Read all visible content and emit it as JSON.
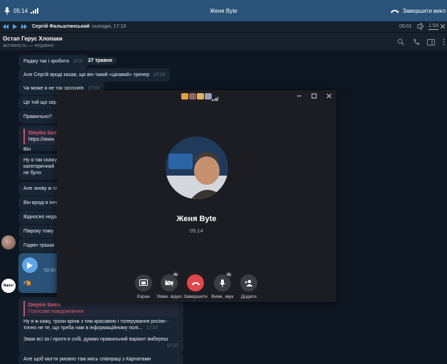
{
  "call_bar": {
    "timer": "05:14",
    "contact_name": "Женя Byte",
    "end_label": "Завершити викл"
  },
  "player_bar": {
    "author": "Сергій Фальштинський",
    "when": "сьогодні, 17:13",
    "position": "00:01",
    "speed": "1.5X"
  },
  "chat_header": {
    "title": "Остап Герус Хлопаки",
    "status": "активність — недавно"
  },
  "chat": {
    "date_pill": "27 травня",
    "messages": [
      {
        "text": "Раджу так і зробити",
        "time": "17:0"
      },
      {
        "text": "Але Сергій вроді казав, що він такий «цікавий» тренер",
        "time": "17:02"
      },
      {
        "text": "Чи може я не так зрозумів",
        "time": "17:03"
      },
      {
        "text": "Це той що зар"
      },
      {
        "text": "Правильно?"
      },
      {
        "reply_name": "Dmytro Som",
        "link": "https://www.",
        "text": "Він"
      },
      {
        "text": "Ну я так скажу",
        "text2": "категоричний",
        "text3": "не було"
      },
      {
        "text": "Але знову ж та"
      },
      {
        "text": "Він вроді в інте"
      },
      {
        "text": "Відносно неда"
      },
      {
        "text": "Півроку тому"
      },
      {
        "text": "Годвін трішки"
      },
      {
        "voice_time": "02:42"
      },
      {
        "reply_name": "Dmytro Soms",
        "reply_sub": "Голосове повідомлення",
        "text": "Ну я ж кажу, трохи крінж з тим красавою і толерування росіян -",
        "text2": "точно не те, що треба нам в інформаційному полі...",
        "time": "17:27"
      },
      {
        "text": "Зваж всі за і проти в собі, думаю правильний варіант вибереш",
        "time": "17:27"
      },
      {
        "text": "Але щоб могти умовно там якісь співпраці з Карпатами"
      }
    ],
    "avatar_label": "Nano!"
  },
  "call_window": {
    "contact_name": "Женя Byte",
    "duration": "05:14",
    "buttons": [
      {
        "label": "Екран",
        "icon": "screen-share-icon"
      },
      {
        "label": "Увімк. відео",
        "icon": "video-off-icon"
      },
      {
        "label": "Завершити",
        "icon": "hangup-icon"
      },
      {
        "label": "Вимк. звук",
        "icon": "microphone-icon"
      },
      {
        "label": "Додати",
        "icon": "add-user-icon"
      }
    ]
  },
  "colors": {
    "call_bar": "#2b5278",
    "panel": "#17212b",
    "chat_bg": "#0e1621",
    "bubble": "#182533",
    "hangup": "#e0464a",
    "accent": "#3d9ee0",
    "reply_accent": "#e35c6e"
  }
}
